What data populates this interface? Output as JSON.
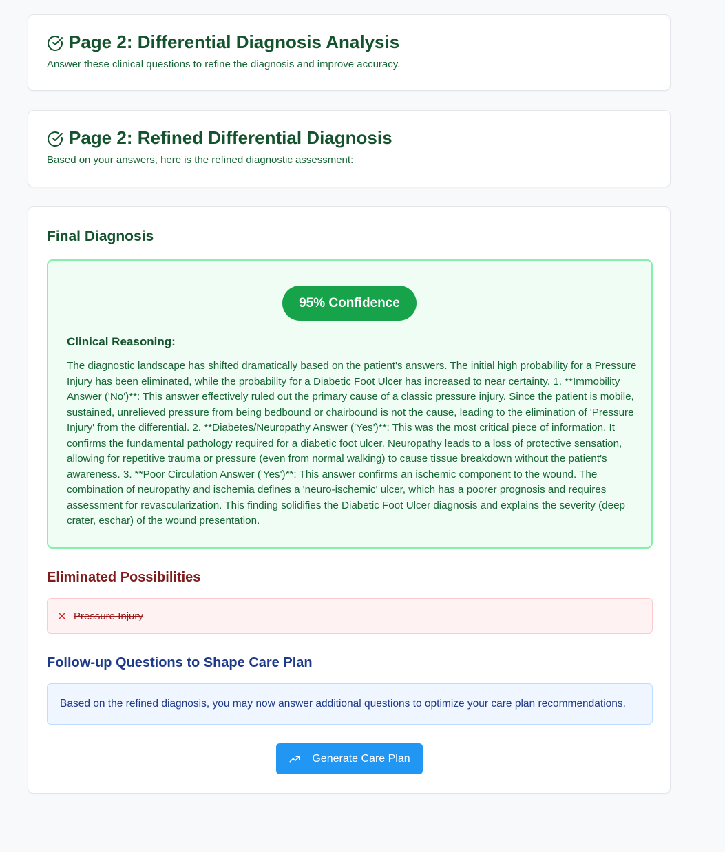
{
  "header1": {
    "title": "Page 2: Differential Diagnosis Analysis",
    "subtitle": "Answer these clinical questions to refine the diagnosis and improve accuracy.",
    "icon": "check-circle-icon"
  },
  "header2": {
    "title": "Page 2: Refined Differential Diagnosis",
    "subtitle": "Based on your answers, here is the refined diagnostic assessment:",
    "icon": "check-circle-icon"
  },
  "final_diagnosis": {
    "title": "Final Diagnosis",
    "confidence": "95% Confidence",
    "reasoning_label": "Clinical Reasoning:",
    "reasoning": "The diagnostic landscape has shifted dramatically based on the patient's answers. The initial high probability for a Pressure Injury has been eliminated, while the probability for a Diabetic Foot Ulcer has increased to near certainty. 1. **Immobility Answer ('No')**: This answer effectively ruled out the primary cause of a classic pressure injury. Since the patient is mobile, sustained, unrelieved pressure from being bedbound or chairbound is not the cause, leading to the elimination of 'Pressure Injury' from the differential. 2. **Diabetes/Neuropathy Answer ('Yes')**: This was the most critical piece of information. It confirms the fundamental pathology required for a diabetic foot ulcer. Neuropathy leads to a loss of protective sensation, allowing for repetitive trauma or pressure (even from normal walking) to cause tissue breakdown without the patient's awareness. 3. **Poor Circulation Answer ('Yes')**: This answer confirms an ischemic component to the wound. The combination of neuropathy and ischemia defines a 'neuro-ischemic' ulcer, which has a poorer prognosis and requires assessment for revascularization. This finding solidifies the Diabetic Foot Ulcer diagnosis and explains the severity (deep crater, eschar) of the wound presentation."
  },
  "eliminated": {
    "title": "Eliminated Possibilities",
    "items": [
      "Pressure Injury"
    ],
    "icon": "x-icon"
  },
  "followup": {
    "title": "Follow-up Questions to Shape Care Plan",
    "info": "Based on the refined diagnosis, you may now answer additional questions to optimize your care plan recommendations."
  },
  "action": {
    "button_label": "Generate Care Plan",
    "icon": "trending-up-icon"
  },
  "colors": {
    "heading_green": "#14532d",
    "confidence_green": "#16a34a",
    "eliminated_red": "#7f1d1d",
    "followup_blue": "#1e3a8a",
    "button_blue": "#2196f3"
  }
}
